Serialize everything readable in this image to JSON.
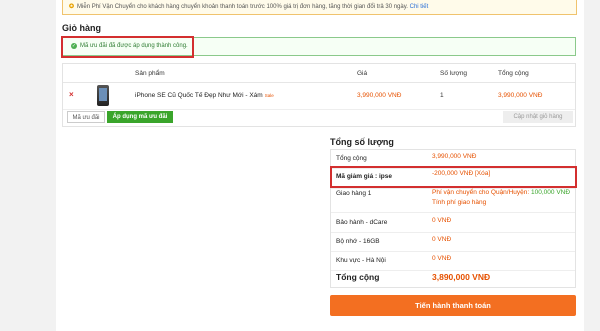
{
  "notice": {
    "text": "Miễn Phí Vận Chuyển cho khách hàng chuyển khoản thanh toán trước 100% giá trị đơn hàng, tăng thời gian đổi trả 30 ngày.",
    "link": "Chi tiết"
  },
  "cart": {
    "title": "Giỏ hàng",
    "success_message": "Mã ưu đãi đã được áp dụng thành công.",
    "columns": {
      "product": "Sản phẩm",
      "price": "Giá",
      "quantity": "Số lượng",
      "total": "Tổng cộng"
    },
    "items": [
      {
        "name": "iPhone SE Cũ Quốc Tế Đẹp Như Mới - Xám",
        "sale_badge": "Sale",
        "price": "3,990,000 VNĐ",
        "quantity": "1",
        "total": "3,990,000 VNĐ"
      }
    ],
    "coupon_placeholder": "Mã ưu đãi",
    "apply_coupon": "Áp dụng mã ưu đãi",
    "update_cart": "Cập nhật giỏ hàng"
  },
  "totals": {
    "title": "Tổng số lượng",
    "subtotal_label": "Tổng cộng",
    "subtotal_value": "3,990,000 VNĐ",
    "coupon_label": "Mã giảm giá : ipse",
    "coupon_value": "-200,000 VNĐ [Xóa]",
    "shipping_label": "Giao hàng 1",
    "shipping_text": "Phí vận chuyển cho Quận/Huyện:",
    "shipping_fee": "100,000 VNĐ",
    "shipping_calc": "Tính phí giao hàng",
    "warranty_label": "Bảo hành - dCare",
    "warranty_value": "0 VNĐ",
    "storage_label": "Bộ nhớ - 16GB",
    "storage_value": "0 VNĐ",
    "region_label": "Khu vực - Hà Nội",
    "region_value": "0 VNĐ",
    "grand_label": "Tổng cộng",
    "grand_value": "3,890,000 VNĐ"
  },
  "checkout_label": "Tiến hành thanh toán",
  "colors": {
    "accent": "#f36f21",
    "price": "#e65100",
    "success": "#3aa52b",
    "highlight": "#d32f2f"
  }
}
